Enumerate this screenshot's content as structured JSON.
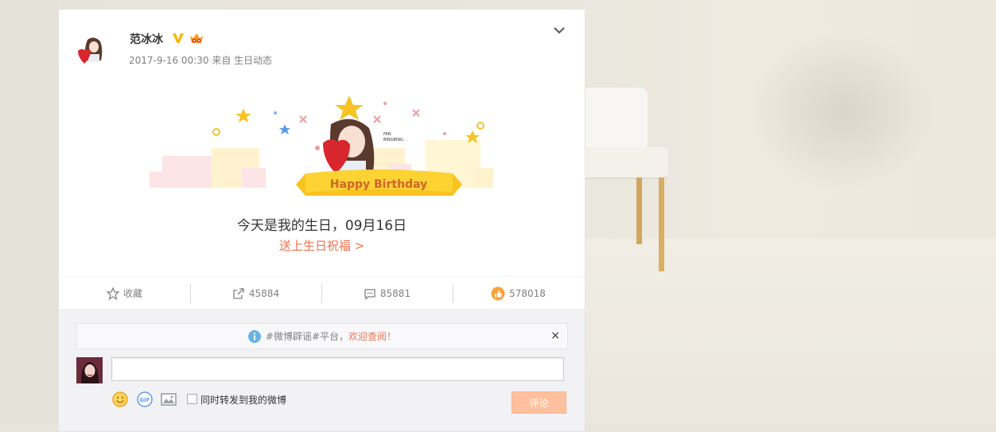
{
  "post": {
    "author": "范冰冰",
    "timestamp": "2017-9-16 00:30",
    "source": "来自 生日动态",
    "banner_text": "Happy Birthday",
    "avatar_caption": "FAN BINGBING",
    "birthday_text": "今天是我的生日，09月16日",
    "birthday_link": "送上生日祝福 >"
  },
  "actions": {
    "favorite_label": "收藏",
    "repost_count": "45884",
    "comment_count": "85881",
    "like_count": "578018"
  },
  "notice": {
    "text_prefix": "#微博辟谣#平台，",
    "text_highlight": "欢迎查阅！",
    "close": "×"
  },
  "composer": {
    "input_value": "",
    "forward_label": "同时转发到我的微博",
    "submit_label": "评论",
    "gif_label": "GIF"
  },
  "icons": {
    "dropdown": "chevron-down-icon",
    "favorite": "star-icon",
    "repost": "repost-icon",
    "comment": "comment-icon",
    "like": "thumb-up-icon",
    "info": "info-icon",
    "emoji": "emoji-icon",
    "gif": "gif-icon",
    "image": "image-icon"
  },
  "colors": {
    "accent": "#eb7350",
    "submit_disabled": "#ffc09f",
    "banner_ribbon": "#f5b400"
  }
}
